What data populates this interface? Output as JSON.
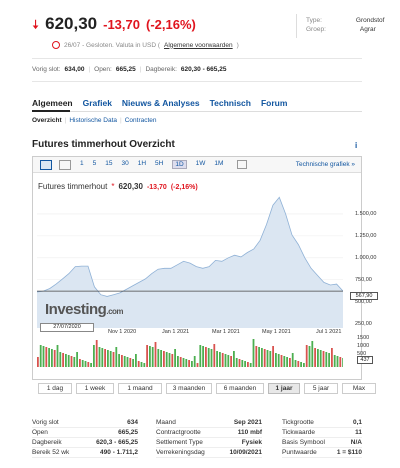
{
  "header": {
    "price": "620,30",
    "change": "-13,70",
    "change_pct": "(-2,16%)",
    "sub_text": "26/07 - Gesloten. Valuta in USD (",
    "sub_link": "Algemene voorwaarden",
    "sub_close": ")"
  },
  "type_info": {
    "type_label": "Type:",
    "type_value": "Grondstof",
    "group_label": "Groep:",
    "group_value": "Agrar"
  },
  "stats": {
    "prev_close_label": "Vorig slot:",
    "prev_close_value": "634,00",
    "open_label": "Open:",
    "open_value": "665,25",
    "range_label": "Dagbereik:",
    "range_value": "620,30 - 665,25"
  },
  "tabs": [
    "Algemeen",
    "Grafiek",
    "Nieuws & Analyses",
    "Technisch",
    "Forum"
  ],
  "subtabs": [
    "Overzicht",
    "Historische Data",
    "Contracten"
  ],
  "section_title": "Futures timmerhout Overzicht",
  "toolbar": {
    "ranges": [
      "1",
      "5",
      "15",
      "30",
      "1H",
      "5H",
      "1D",
      "1W",
      "1M"
    ],
    "selected": "1D",
    "tech_link": "Technische grafiek »"
  },
  "chart_header": {
    "name": "Futures timmerhout",
    "price": "620,30",
    "change": "-13,70",
    "change_pct": "(-2,16%)"
  },
  "watermark": {
    "brand": "Investing",
    "suffix": ".com"
  },
  "date_tag": "27/07/2020",
  "price_tag": "567,90",
  "vol_tag": "437",
  "chart_data": {
    "type": "area",
    "title": "Futures timmerhout",
    "x_ticks": [
      "Nov 1 2020",
      "Jan 1 2021",
      "Mar 1 2021",
      "May 1 2021",
      "Jul 1 2021"
    ],
    "y_ticks": [
      1500,
      1250,
      1000,
      750,
      500,
      250
    ],
    "y_tick_labels": [
      "1.500,00",
      "1.250,00",
      "1.000,00",
      "750,00",
      "500,00",
      "250,00"
    ],
    "ylim": [
      200,
      1750
    ],
    "series": [
      {
        "values": [
          610,
          620,
          650,
          700,
          760,
          820,
          900,
          905,
          905,
          670,
          580,
          560,
          580,
          600,
          640,
          680,
          720,
          760,
          820,
          870,
          880,
          880,
          920,
          960,
          940,
          900,
          880,
          900,
          970,
          960,
          1000,
          1030,
          1010,
          1060,
          1100,
          1200,
          1380,
          1600,
          1690,
          1500,
          1260,
          1150,
          1000,
          880,
          800,
          720,
          690,
          700,
          620
        ]
      }
    ],
    "volume_ylim": [
      0,
      2000
    ],
    "volume_ticks": [
      "1500",
      "1000",
      "500"
    ]
  },
  "range_buttons": [
    "1 dag",
    "1 week",
    "1 maand",
    "3 maanden",
    "6 maanden",
    "1 jaar",
    "5 jaar",
    "Max"
  ],
  "range_selected": "1 jaar",
  "table": {
    "col1": [
      [
        "Vorig slot",
        "634"
      ],
      [
        "Open",
        "665,25"
      ],
      [
        "Dagbereik",
        "620,3 - 665,25"
      ],
      [
        "Bereik 52 wk",
        "490 - 1.711,2"
      ]
    ],
    "col2": [
      [
        "Maand",
        "Sep 2021"
      ],
      [
        "Contractgrootte",
        "110 mbf"
      ],
      [
        "Settlement Type",
        "Fysiek"
      ],
      [
        "Verrekeningsdag",
        "10/09/2021"
      ]
    ],
    "col3": [
      [
        "Tickgrootte",
        "0,1"
      ],
      [
        "Tickwaarde",
        "11"
      ],
      [
        "Basis Symbool",
        "N/A"
      ],
      [
        "Puntwaarde",
        "1 = $110"
      ]
    ]
  },
  "colors": {
    "down": "#e0141e",
    "link": "#1256a0",
    "area_fill": "#dbe6f2",
    "area_line": "#8fb1d6"
  }
}
